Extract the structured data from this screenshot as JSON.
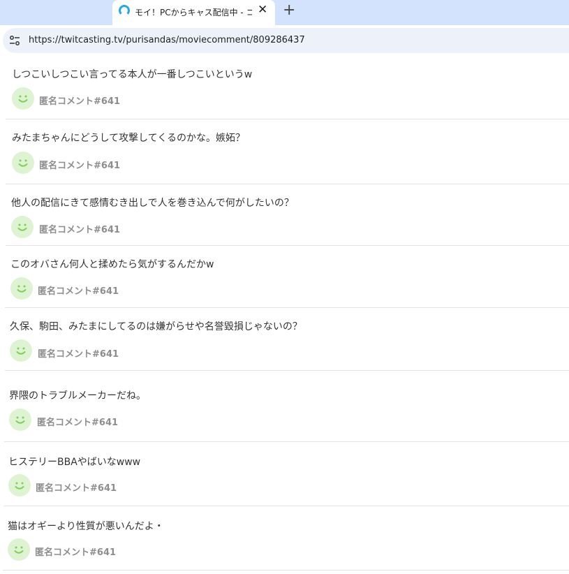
{
  "browser": {
    "tab_title": "モイ！PCからキャス配信中 - コメント",
    "new_tab_label": "+",
    "close_label": "✕",
    "url": "https://twitcasting.tv/purisandas/moviecomment/809286437"
  },
  "comments": [
    {
      "text": "しつこいしつこい言ってる本人が一番しつこいというw",
      "user": "匿名コメント#641"
    },
    {
      "text": "みたまちゃんにどうして攻撃してくるのかな。嫉妬？",
      "user": "匿名コメント#641"
    },
    {
      "text": "他人の配信にきて感情むき出しで人を巻き込んで何がしたいの？",
      "user": "匿名コメント#641"
    },
    {
      "text": "このオバさん何人と揉めたら気がするんだかw",
      "user": "匿名コメント#641"
    },
    {
      "text": "久保、駒田、みたまにしてるのは嫌がらせや名誉毀損じゃないの？",
      "user": "匿名コメント#641"
    },
    {
      "text": "界隈のトラブルメーカーだね。",
      "user": "匿名コメント#641"
    },
    {
      "text": "ヒステリーBBAやばいなwww",
      "user": "匿名コメント#641"
    },
    {
      "text": "猫はオギーより性質が悪いんだよ・",
      "user": "匿名コメント#641"
    }
  ],
  "colors": {
    "tabbar_bg": "#d3e3fd",
    "omnibox_bg": "#edf2fa",
    "avatar_bg": "#def3d2",
    "avatar_face": "#7fcf5a",
    "username": "#8d8d8d"
  }
}
